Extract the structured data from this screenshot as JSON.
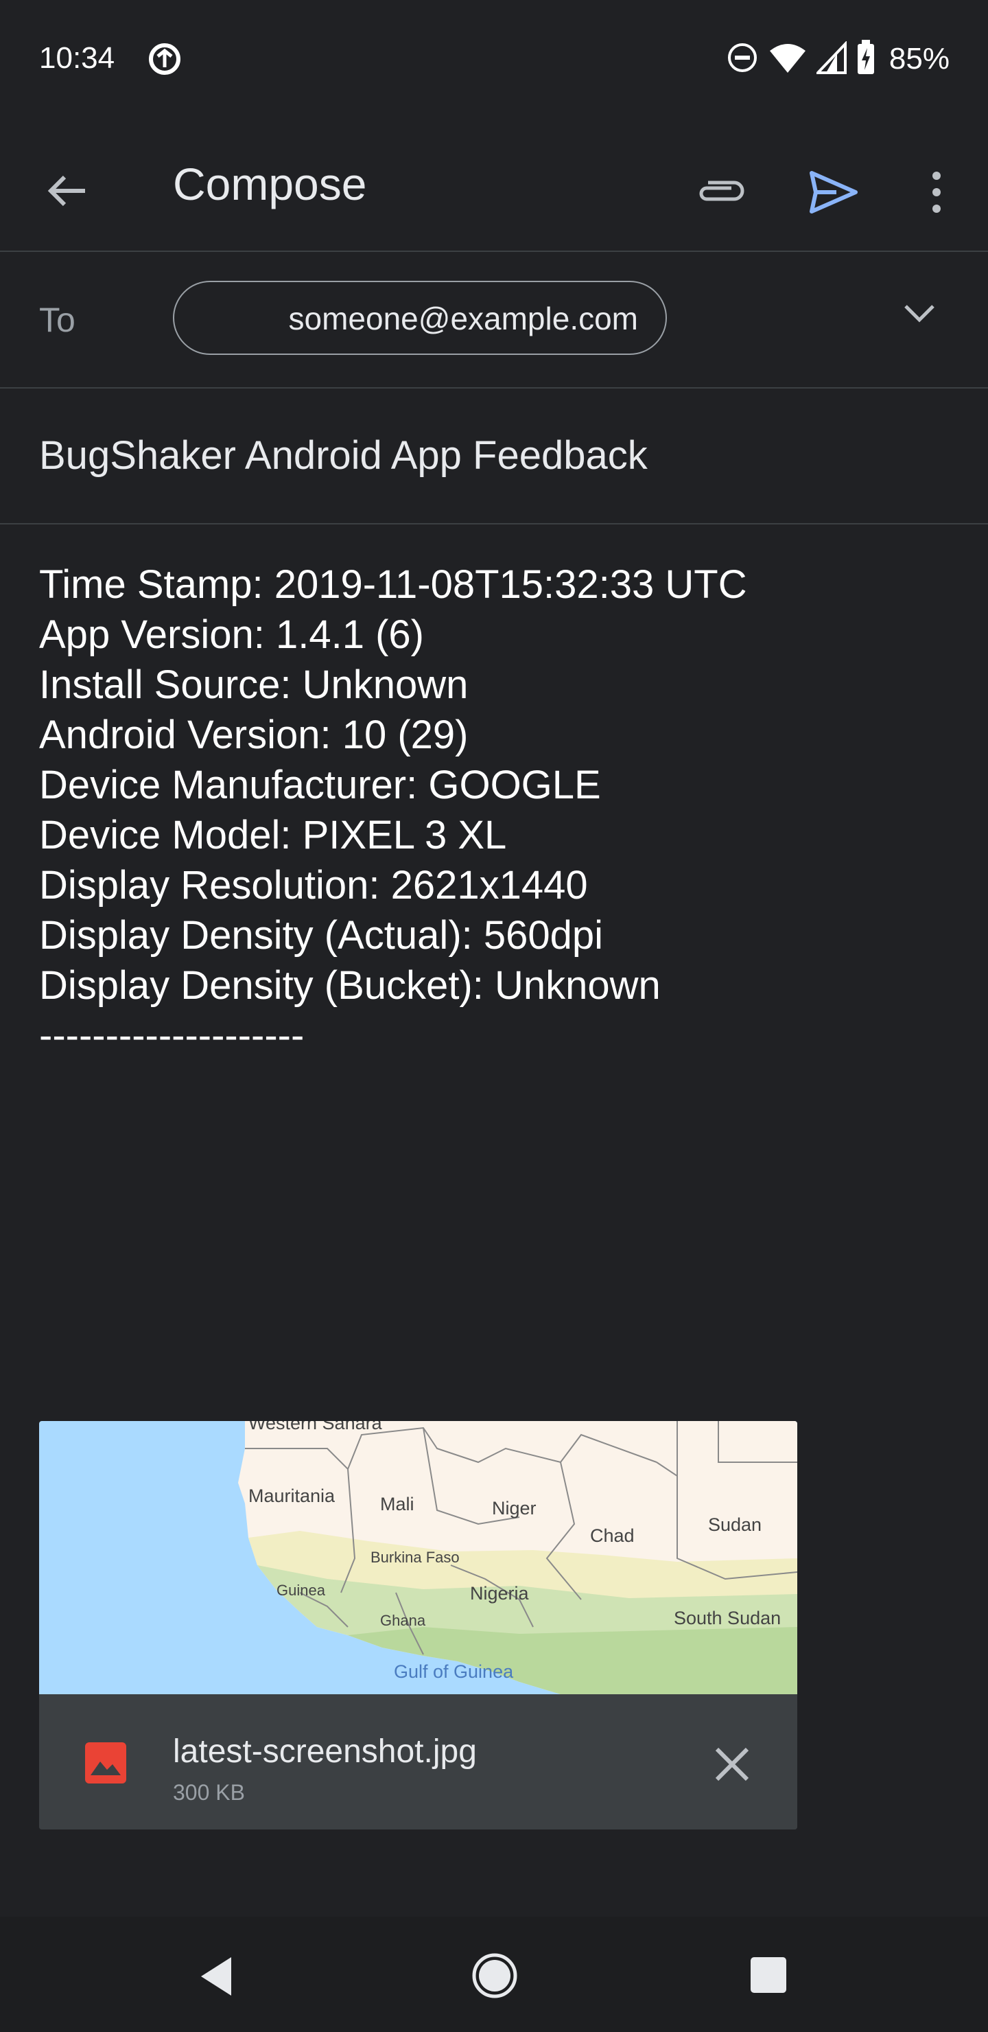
{
  "status_bar": {
    "time": "10:34",
    "battery": "85%",
    "icons": [
      "sync-icon",
      "do-not-disturb-icon",
      "wifi-icon",
      "signal-icon",
      "battery-charging-icon"
    ]
  },
  "app_bar": {
    "title": "Compose",
    "icons": [
      "back-arrow-icon",
      "paperclip-icon",
      "send-icon",
      "more-vert-icon"
    ],
    "send_color": "#8ab4f8"
  },
  "compose": {
    "to_label": "To",
    "recipient": "someone@example.com",
    "subject": "BugShaker Android App Feedback",
    "body_lines": [
      "Time Stamp: 2019-11-08T15:32:33 UTC",
      "App Version: 1.4.1 (6)",
      "Install Source: Unknown",
      "Android Version: 10 (29)",
      "Device Manufacturer: GOOGLE",
      "Device Model: PIXEL 3 XL",
      "Display Resolution: 2621x1440",
      "Display Density (Actual): 560dpi",
      "Display Density (Bucket): Unknown",
      "--------------------"
    ]
  },
  "attachment": {
    "file_name": "latest-screenshot.jpg",
    "file_size": "300 KB",
    "icon": "image-icon",
    "icon_color": "#ea4335",
    "map_labels": {
      "western_sahara": "Western Sahara",
      "mauritania": "Mauritania",
      "mali": "Mali",
      "niger": "Niger",
      "chad": "Chad",
      "sudan": "Sudan",
      "burkina_faso": "Burkina Faso",
      "guinea": "Guinea",
      "nigeria": "Nigeria",
      "ghana": "Ghana",
      "south_sudan": "South Sudan",
      "gulf": "Gulf of Guinea"
    }
  },
  "nav_bar": {
    "icons": [
      "nav-back-icon",
      "nav-home-icon",
      "nav-recents-icon"
    ]
  }
}
